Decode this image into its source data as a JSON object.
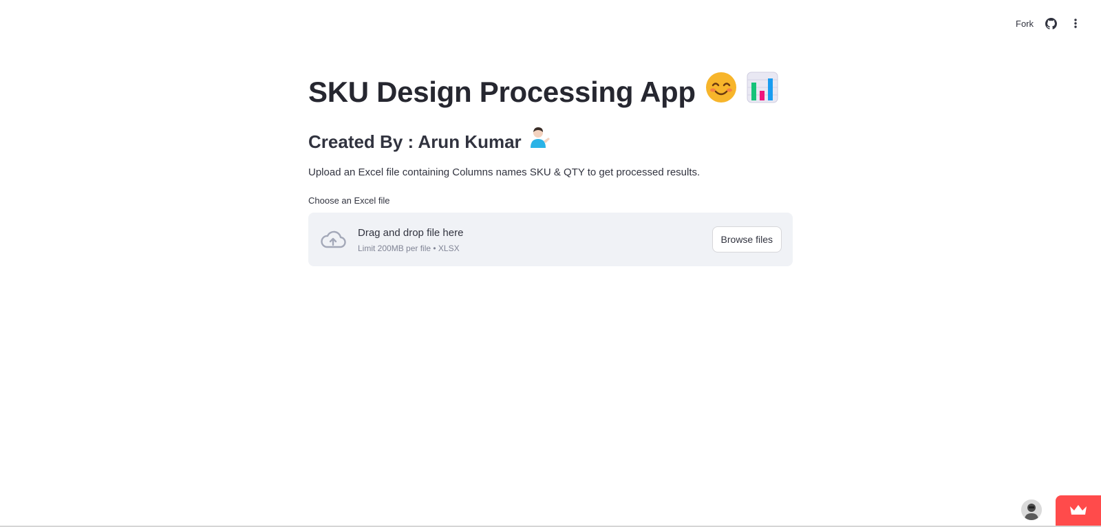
{
  "header": {
    "fork_label": "Fork",
    "github_icon": "github-icon",
    "menu_icon": "more-vertical-icon"
  },
  "main": {
    "title": "SKU Design Processing App",
    "title_emojis": [
      "😊",
      "📊"
    ],
    "subtitle": "Created By : Arun Kumar",
    "subtitle_emoji": "💁🏻‍♂️",
    "description": "Upload an Excel file containing Columns names SKU & QTY to get processed results.",
    "uploader": {
      "label": "Choose an Excel file",
      "drop_text": "Drag and drop file here",
      "limit_text": "Limit 200MB per file • XLSX",
      "button_label": "Browse files",
      "icon": "cloud-upload-icon"
    }
  },
  "footer": {
    "avatar_icon": "user-avatar",
    "badge_icon": "crown-icon",
    "badge_color": "#ff4b4b"
  }
}
